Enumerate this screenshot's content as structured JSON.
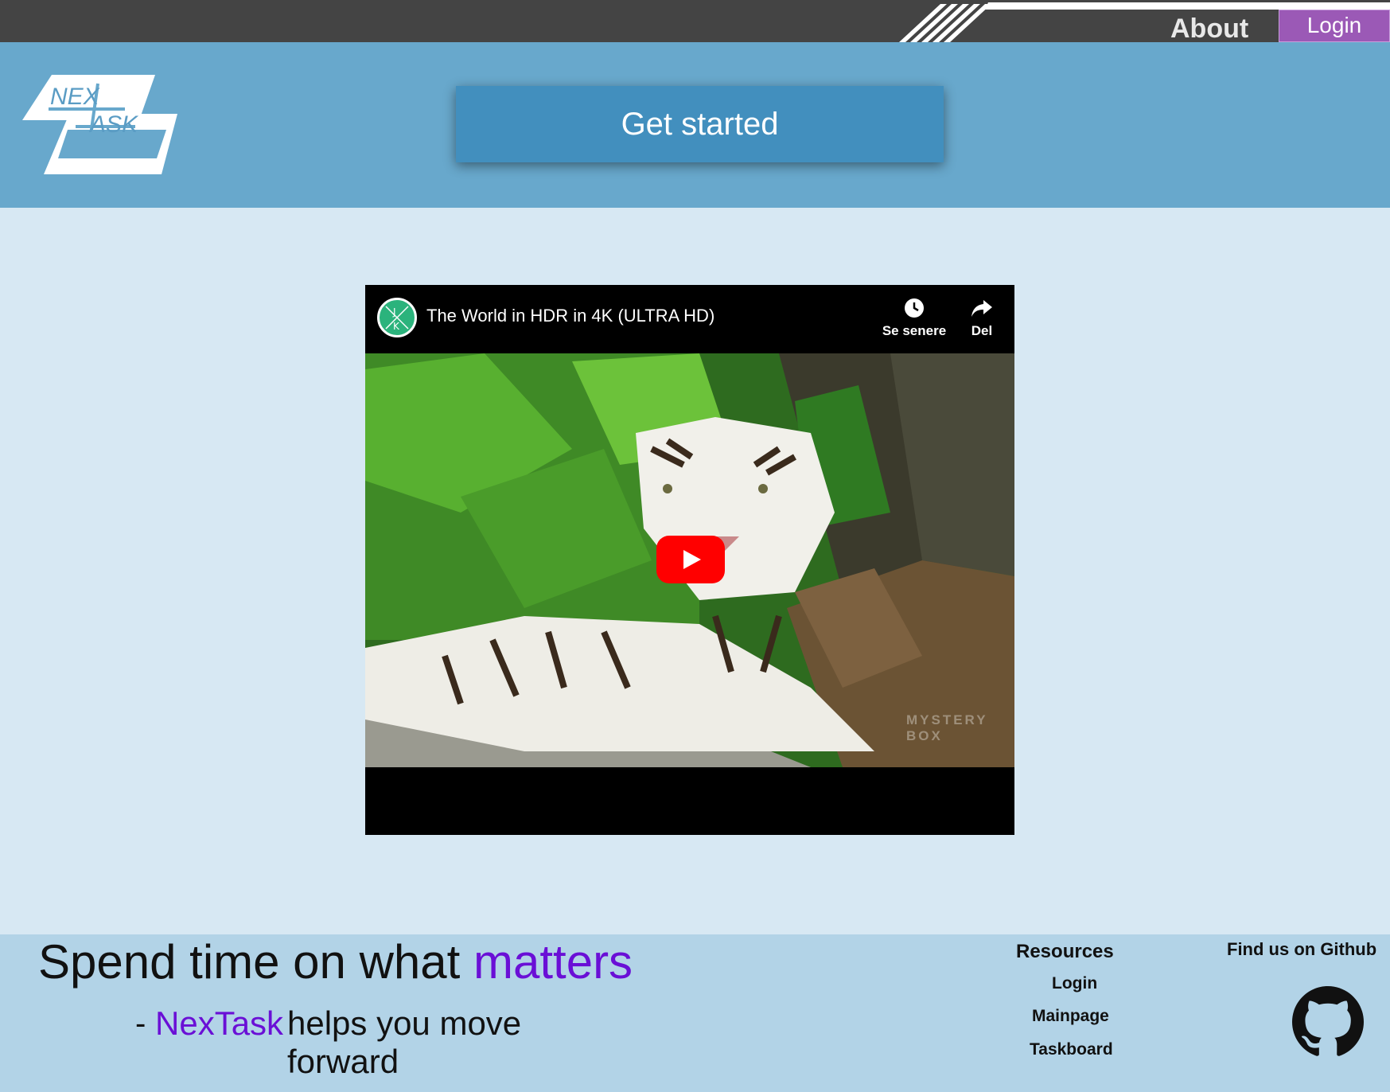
{
  "nav": {
    "about_label": "About",
    "login_label": "Login"
  },
  "header": {
    "logo_top_text": "NEX",
    "logo_bottom_text": "ASK",
    "get_started_label": "Get started"
  },
  "video": {
    "channel_avatar_text": "J K",
    "title": "The World in HDR in 4K (ULTRA HD)",
    "watch_later_label": "Se senere",
    "share_label": "Del",
    "watermark": "MYSTERY BOX",
    "thumbnail_description_icon": "tiger-thumbnail-image"
  },
  "footer": {
    "tagline_prefix": "Spend time on what ",
    "tagline_accent": "matters",
    "dash": "-",
    "brand": "NexTask",
    "subline": "helps you move forward",
    "resources": {
      "title": "Resources",
      "links": [
        "Login",
        "Mainpage",
        "Taskboard"
      ]
    },
    "github_title": "Find us on Github"
  },
  "colors": {
    "topbar": "#444444",
    "header": "#68a8cc",
    "button": "#428fbe",
    "login": "#9b59b6",
    "accent": "#6a0fd6",
    "page_bg": "#d7e8f3",
    "footer_bg": "#b2d3e7"
  }
}
